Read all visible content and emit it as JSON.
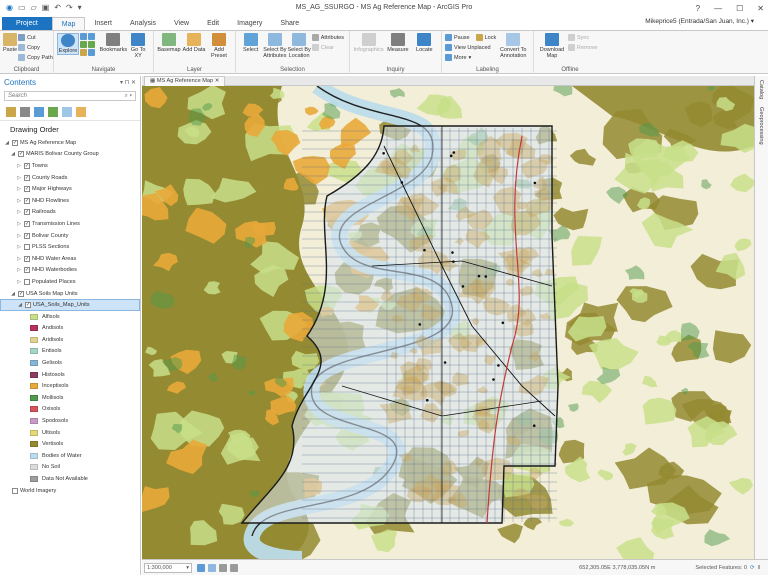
{
  "titlebar": {
    "title": "MS_AG_SSURGO - MS Ag Reference Map - ArcGIS Pro",
    "help": "?",
    "minimize": "—",
    "maximize": "☐",
    "close": "✕"
  },
  "tabs": [
    {
      "label": "Project"
    },
    {
      "label": "Map"
    },
    {
      "label": "Insert"
    },
    {
      "label": "Analysis"
    },
    {
      "label": "View"
    },
    {
      "label": "Edit"
    },
    {
      "label": "Imagery"
    },
    {
      "label": "Share"
    }
  ],
  "user": "Mikeprice5 (Entrada/San Juan, Inc.) ▾",
  "ribbon": {
    "clipboard": {
      "label": "Clipboard",
      "paste": "Paste",
      "cut": "Cut",
      "copy": "Copy",
      "copy_path": "Copy Path"
    },
    "navigate": {
      "label": "Navigate",
      "explore": "Explore",
      "bookmarks": "Bookmarks",
      "go_to_xy": "Go To XY"
    },
    "layer": {
      "label": "Layer",
      "basemap": "Basemap",
      "add_data": "Add Data",
      "add_preset": "Add Preset"
    },
    "selection": {
      "label": "Selection",
      "select": "Select",
      "by_attributes": "Select By Attributes",
      "by_location": "Select By Location",
      "attributes": "Attributes",
      "clear": "Clear"
    },
    "inquiry": {
      "label": "Inquiry",
      "infographics": "Infographics",
      "measure": "Measure",
      "locate": "Locate"
    },
    "labeling": {
      "label": "Labeling",
      "pause": "Pause",
      "lock": "Lock",
      "view_unplaced": "View Unplaced",
      "more": "More",
      "convert": "Convert To Annotation"
    },
    "offline": {
      "label": "Offline",
      "download": "Download Map",
      "sync": "Sync",
      "remove": "Remove"
    }
  },
  "contents": {
    "title": "Contents",
    "search_placeholder": "Search",
    "drawing_order": "Drawing Order",
    "items": [
      {
        "label": "MS Ag Reference Map",
        "checked": true,
        "level": 0,
        "caret": "◢"
      },
      {
        "label": "MARIS Bolivar County Group",
        "checked": true,
        "level": 1,
        "caret": "◢"
      },
      {
        "label": "Towns",
        "checked": true,
        "level": 2,
        "caret": "▷"
      },
      {
        "label": "County Roads",
        "checked": true,
        "level": 2,
        "caret": "▷"
      },
      {
        "label": "Major Highways",
        "checked": true,
        "level": 2,
        "caret": "▷"
      },
      {
        "label": "NHD Flowlines",
        "checked": true,
        "level": 2,
        "caret": "▷"
      },
      {
        "label": "Railroads",
        "checked": true,
        "level": 2,
        "caret": "▷"
      },
      {
        "label": "Transmission Lines",
        "checked": true,
        "level": 2,
        "caret": "▷"
      },
      {
        "label": "Bolivar County",
        "checked": true,
        "level": 2,
        "caret": "▷"
      },
      {
        "label": "PLSS Sections",
        "checked": false,
        "level": 2,
        "caret": "▷"
      },
      {
        "label": "NHD Water Areas",
        "checked": true,
        "level": 2,
        "caret": "▷"
      },
      {
        "label": "NHD Waterbodies",
        "checked": true,
        "level": 2,
        "caret": "▷"
      },
      {
        "label": "Populated Places",
        "checked": false,
        "level": 2,
        "caret": "▷"
      },
      {
        "label": "USA Soils Map Units",
        "checked": true,
        "level": 1,
        "caret": "◢"
      },
      {
        "label": "USA_Soils_Map_Units",
        "checked": true,
        "level": 2,
        "caret": "◢",
        "selected": true
      }
    ],
    "legend": [
      {
        "label": "Alfisols",
        "color": "#c8df8a"
      },
      {
        "label": "Andisols",
        "color": "#b5335a"
      },
      {
        "label": "Aridisols",
        "color": "#e2d392"
      },
      {
        "label": "Entisols",
        "color": "#a6d7c3"
      },
      {
        "label": "Gelisols",
        "color": "#85b8d8"
      },
      {
        "label": "Histosols",
        "color": "#8c3c62"
      },
      {
        "label": "Inceptisols",
        "color": "#e9a93a"
      },
      {
        "label": "Mollisols",
        "color": "#4f9a4c"
      },
      {
        "label": "Oxisols",
        "color": "#d4545a"
      },
      {
        "label": "Spodosols",
        "color": "#c89ac6"
      },
      {
        "label": "Ultisols",
        "color": "#e4d877"
      },
      {
        "label": "Vertisols",
        "color": "#948a31"
      },
      {
        "label": "Bodies of Water",
        "color": "#bcdcea"
      },
      {
        "label": "No Soil",
        "color": "#dcdcdc"
      },
      {
        "label": "Data Not Available",
        "color": "#9e9e9e"
      }
    ],
    "world_imagery": "World Imagery"
  },
  "map": {
    "tab": "MS Ag Reference Map"
  },
  "dock": {
    "catalog": "Catalog",
    "geoprocessing": "Geoprocessing"
  },
  "status": {
    "scale": "1:300,000",
    "coords": "652,305.05E 3,778,035.05N m",
    "selected": "Selected Features: 0"
  },
  "colors": {
    "accent": "#1c73c2",
    "vertisol": "#948a31",
    "alfisol": "#c8df8a",
    "inceptisol": "#e9a93a",
    "water": "#bcdcea",
    "boundary": "#1a1a1a",
    "highway": "#c23b3b"
  }
}
